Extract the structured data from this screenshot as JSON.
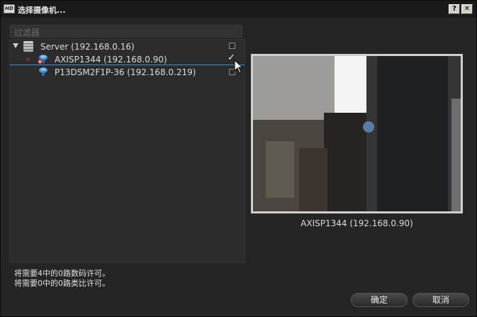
{
  "window": {
    "title": "选择摄像机...",
    "app_icon_text": "HD",
    "help_label": "?",
    "close_label": "✕"
  },
  "filter": {
    "placeholder": "过滤器"
  },
  "tree": {
    "server": {
      "label": "Server (192.168.0.16)",
      "expanded": true,
      "checked": false
    },
    "cameras": [
      {
        "label": "AXISP1344 (192.168.0.90)",
        "checked": true,
        "status": "error"
      },
      {
        "label": "P13DSM2F1P-36 (192.168.0.219)",
        "checked": false
      }
    ]
  },
  "preview": {
    "caption": "AXISP1344 (192.168.0.90)"
  },
  "info": {
    "line1": "将需要4中的0路数码许可。",
    "line2": "将需要0中的0路类比许可。"
  },
  "buttons": {
    "ok": "确定",
    "cancel": "取消"
  },
  "colors": {
    "selection_line": "#3f8fd0",
    "background": "#252525"
  },
  "icons": [
    "expand-triangle-icon",
    "server-icon",
    "camera-icon",
    "error-badge-icon",
    "checkbox-icon",
    "mouse-cursor-icon"
  ]
}
